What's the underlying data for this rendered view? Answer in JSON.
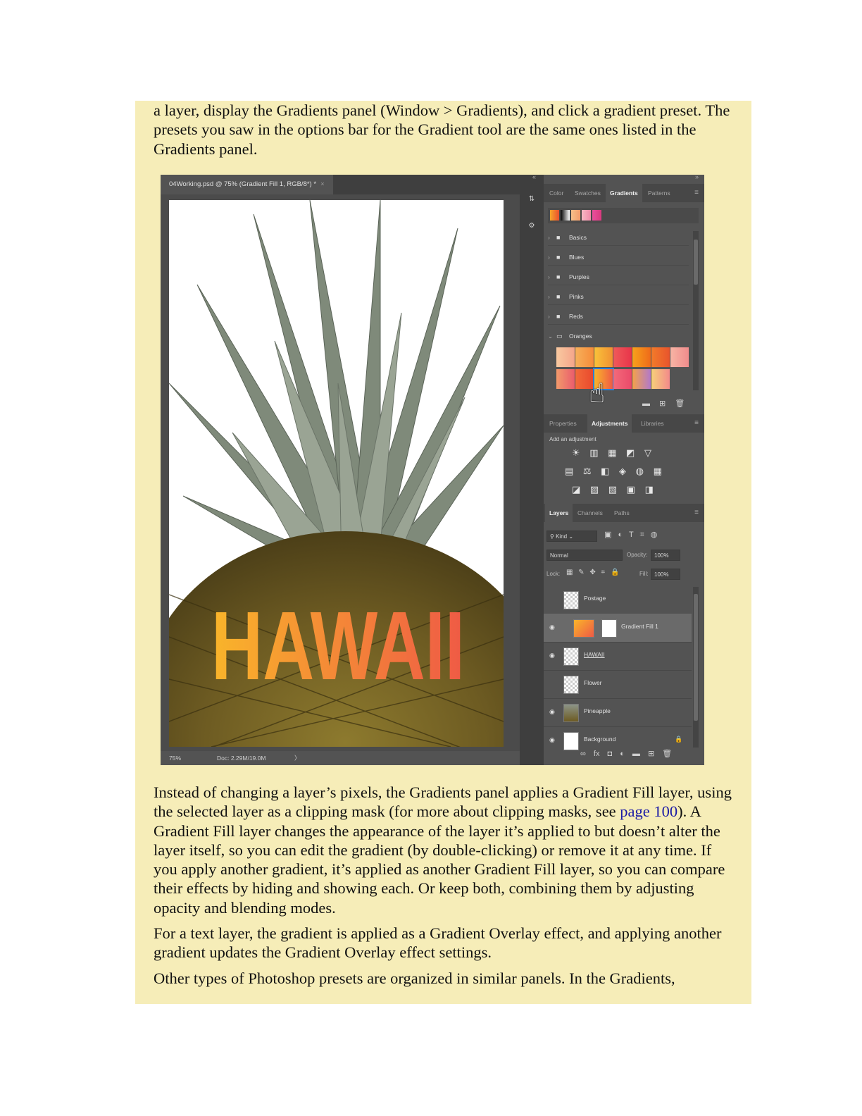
{
  "text": {
    "para1": "a layer, display the Gradients panel (Window > Gradients), and click a gradient preset. The presets you saw in the options bar for the Gradient tool are the same ones listed in the Gradients panel.",
    "para2_before": "Instead of changing a layer’s pixels, the Gradients panel applies a Gradient Fill layer, using the selected layer as a clipping mask (for more about clipping masks, see ",
    "para2_link": "page 100",
    "para2_after": "). A Gradient Fill layer changes the appearance of the layer it’s applied to but doesn’t alter the layer itself, so you can edit the gradient (by double-clicking) or remove it at any time. If you apply another gradient, it’s applied as another Gradient Fill layer, so you can compare their effects by hiding and showing each. Or keep both, combining them by adjusting opacity and blending modes.",
    "para3": "For a text layer, the gradient is applied as a Gradient Overlay effect, and applying another gradient updates the Gradient Overlay effect settings.",
    "para4": "Other types of Photoshop presets are organized in similar panels. In the Gradients,"
  },
  "screenshot": {
    "document_tab": "04Working.psd @ 75% (Gradient Fill 1, RGB/8*) *",
    "close_glyph": "×",
    "canvas_text": "HAWAII",
    "status_zoom": "75%",
    "status_doc": "Doc: 2.29M/19.0M",
    "status_arrow": "〉",
    "collapse_left": "«",
    "collapse_right": "»",
    "panel_group1_tabs": [
      "Color",
      "Swatches",
      "Gradients",
      "Patterns"
    ],
    "gradient_folders": [
      "Basics",
      "Blues",
      "Purples",
      "Pinks",
      "Reds",
      "Oranges"
    ],
    "panel_group2_tabs": [
      "Properties",
      "Adjustments",
      "Libraries"
    ],
    "adjustments_label": "Add an adjustment",
    "adjust_icons_row1": "☀ ▥ ▦ ◩ ▽",
    "adjust_icons_row2": "▤ ⚖ ◧ ◈ ◍ ▦",
    "adjust_icons_row3": "◪ ▨ ▧ ▣ ◨",
    "panel_group3_tabs": [
      "Layers",
      "Channels",
      "Paths"
    ],
    "filter_kind": "Kind",
    "blend_mode": "Normal",
    "opacity_label": "Opacity:",
    "opacity_value": "100%",
    "lock_label": "Lock:",
    "fill_label": "Fill:",
    "fill_value": "100%",
    "layers": [
      "Postage",
      "Gradient Fill 1",
      "HAWAII",
      "Flower",
      "Pineapple",
      "Background"
    ],
    "gradient_footer_icons": "▬ ⊞ 🗑",
    "layers_footer_icons": "∞ fx ◘ ◐ ▬ ⊞ 🗑",
    "filter_icons": "▣ ◐ T ⌗ ◍",
    "lock_icons": "▦ ✎ ✥ ⌗ 🔒"
  },
  "colors": {
    "sidebar_bg": "#f6edb8",
    "link": "#1a1aa6",
    "hawaii_gradient_start": "#f9b52a",
    "hawaii_gradient_end": "#ef5a45"
  }
}
